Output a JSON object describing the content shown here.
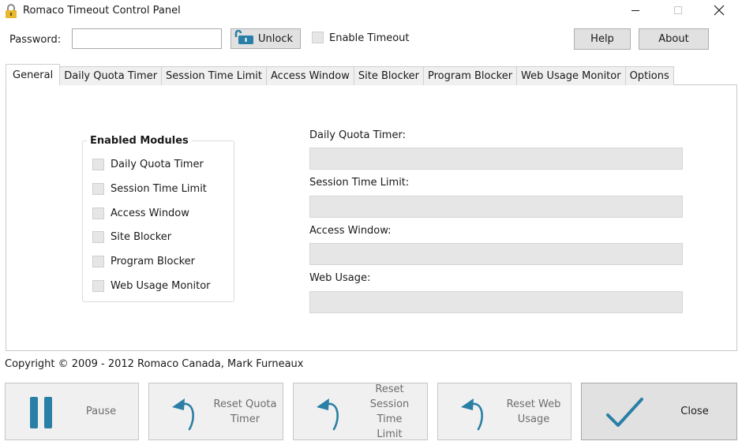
{
  "window": {
    "title": "Romaco Timeout Control Panel",
    "icon": "padlock-icon",
    "controls": {
      "minimize": "minimize-icon",
      "maximize": "maximize-icon",
      "close": "close-icon"
    }
  },
  "toolbar": {
    "password_label": "Password:",
    "password_value": "",
    "password_placeholder": "",
    "unlock_label": "Unlock",
    "unlock_icon": "unlock-icon",
    "enable_timeout_label": "Enable Timeout",
    "enable_timeout_checked": false,
    "help_label": "Help",
    "about_label": "About"
  },
  "tabs": [
    {
      "label": "General",
      "active": true
    },
    {
      "label": "Daily Quota Timer",
      "active": false
    },
    {
      "label": "Session Time Limit",
      "active": false
    },
    {
      "label": "Access Window",
      "active": false
    },
    {
      "label": "Site Blocker",
      "active": false
    },
    {
      "label": "Program Blocker",
      "active": false
    },
    {
      "label": "Web Usage Monitor",
      "active": false
    },
    {
      "label": "Options",
      "active": false
    }
  ],
  "general": {
    "enabled_modules": {
      "title": "Enabled Modules",
      "items": [
        {
          "label": "Daily Quota Timer",
          "checked": false
        },
        {
          "label": "Session Time Limit",
          "checked": false
        },
        {
          "label": "Access Window",
          "checked": false
        },
        {
          "label": "Site Blocker",
          "checked": false
        },
        {
          "label": "Program Blocker",
          "checked": false
        },
        {
          "label": "Web Usage Monitor",
          "checked": false
        }
      ]
    },
    "status_fields": [
      {
        "label": "Daily Quota Timer:",
        "value": ""
      },
      {
        "label": "Session Time Limit:",
        "value": ""
      },
      {
        "label": "Access Window:",
        "value": ""
      },
      {
        "label": "Web Usage:",
        "value": ""
      }
    ]
  },
  "copyright": "Copyright © 2009 - 2012 Romaco Canada, Mark Furneaux",
  "actions": {
    "pause": {
      "label": "Pause",
      "icon": "pause-icon"
    },
    "reset_quota": {
      "label": "Reset Quota\nTimer",
      "icon": "undo-arrow-icon"
    },
    "reset_session": {
      "label": "Reset\nSession Time\nLimit",
      "icon": "undo-arrow-icon"
    },
    "reset_web": {
      "label": "Reset Web\nUsage",
      "icon": "undo-arrow-icon"
    },
    "close": {
      "label": "Close",
      "icon": "checkmark-icon"
    }
  },
  "colors": {
    "accent": "#2a7fa6",
    "lock_yellow": "#e8b92f",
    "disabled_field": "#e6e6e6",
    "button_face": "#e1e1e1"
  }
}
